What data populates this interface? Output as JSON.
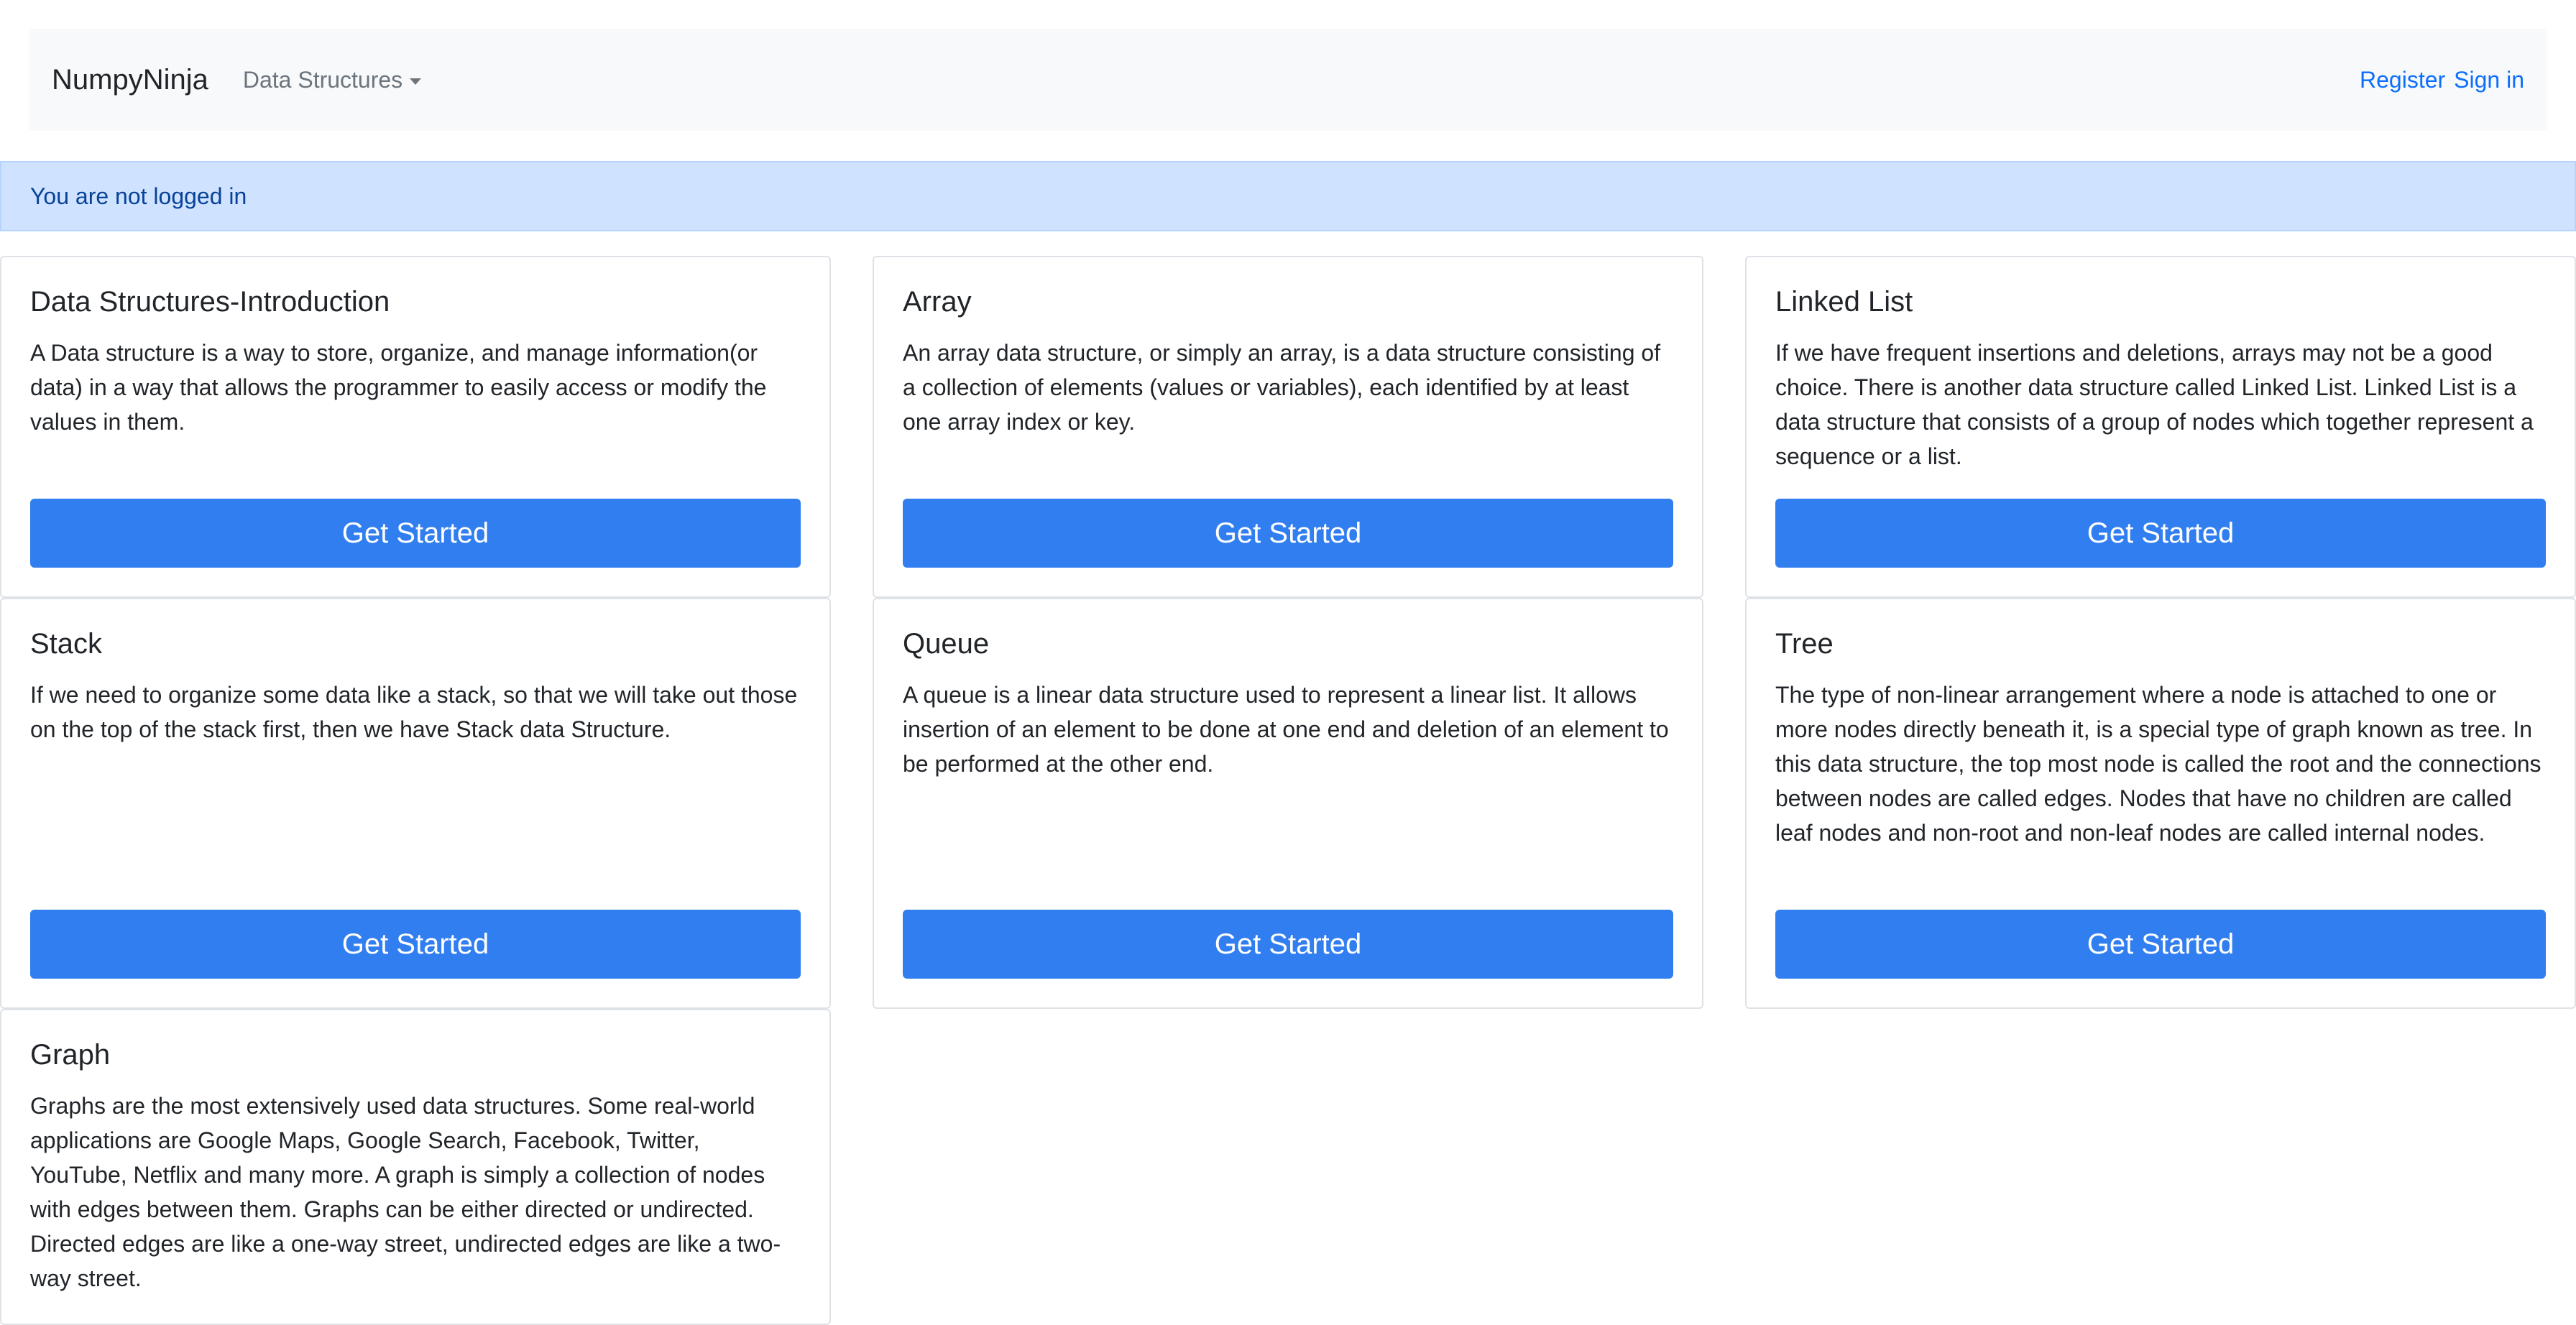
{
  "navbar": {
    "brand": "NumpyNinja",
    "dropdown_label": "Data Structures",
    "register": "Register",
    "signin": "Sign in"
  },
  "alert": {
    "text": "You are not logged in"
  },
  "cards": [
    {
      "title": "Data Structures-Introduction",
      "text": "A Data structure is a way to store, organize, and manage information(or data) in a way that allows the programmer to easily access or modify the values in them.",
      "button": "Get Started"
    },
    {
      "title": "Array",
      "text": "An array data structure, or simply an array, is a data structure consisting of a collection of elements (values or variables), each identified by at least one array index or key.",
      "button": "Get Started"
    },
    {
      "title": "Linked List",
      "text": "If we have frequent insertions and deletions, arrays may not be a good choice. There is another data structure called Linked List. Linked List is a data structure that consists of a group of nodes which together represent a sequence or a list.",
      "button": "Get Started"
    },
    {
      "title": "Stack",
      "text": "If we need to organize some data like a stack, so that we will take out those on the top of the stack first, then we have Stack data Structure.",
      "button": "Get Started"
    },
    {
      "title": "Queue",
      "text": "A queue is a linear data structure used to represent a linear list. It allows insertion of an element to be done at one end and deletion of an element to be performed at the other end.",
      "button": "Get Started"
    },
    {
      "title": "Tree",
      "text": "The type of non-linear arrangement where a node is attached to one or more nodes directly beneath it, is a special type of graph known as tree. In this data structure, the top most node is called the root and the connections between nodes are called edges. Nodes that have no children are called leaf nodes and non-root and non-leaf nodes are called internal nodes.",
      "button": "Get Started"
    },
    {
      "title": "Graph",
      "text": "Graphs are the most extensively used data structures. Some real-world applications are Google Maps, Google Search, Facebook, Twitter, YouTube, Netflix and many more. A graph is simply a collection of nodes with edges between them. Graphs can be either directed or undirected. Directed edges are like a one-way street, undirected edges are like a two-way street."
    }
  ]
}
